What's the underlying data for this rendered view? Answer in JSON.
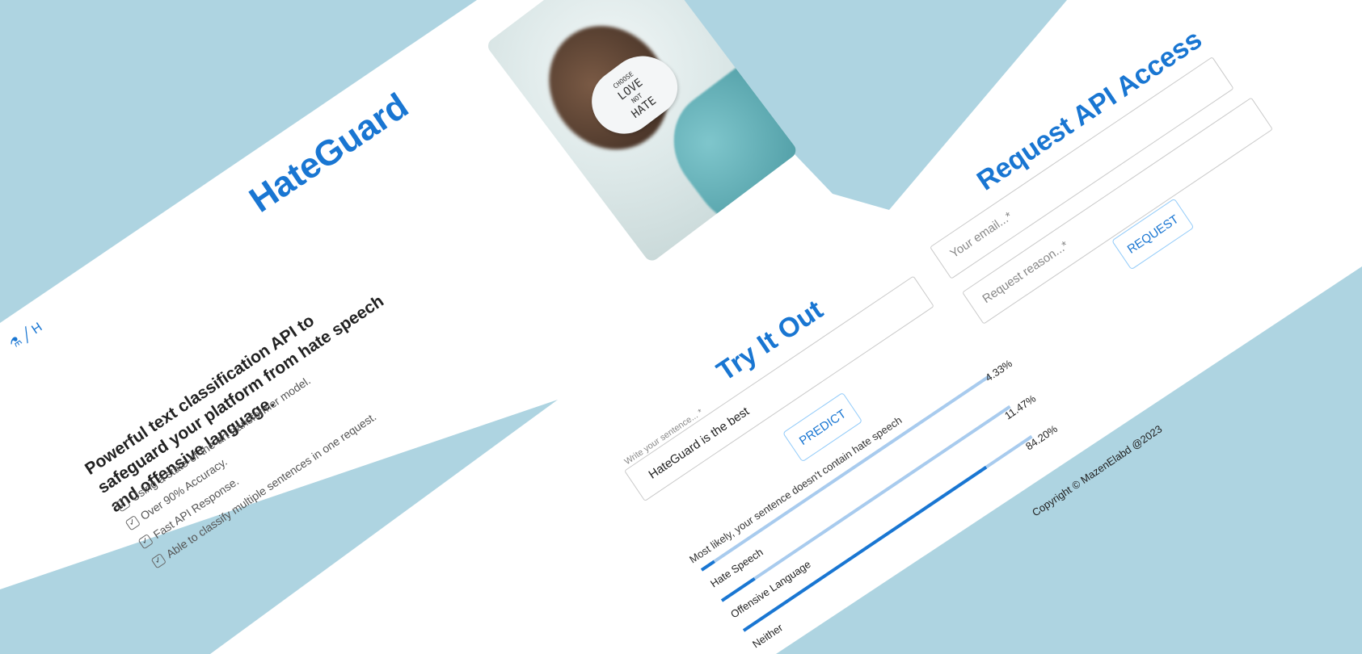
{
  "brand": {
    "title": "HateGuard",
    "nav_letter": "H"
  },
  "hero": {
    "tagline": "Powerful text classification API to safeguard your platform from hate speech and offensive language.",
    "features": [
      "Using a state-of-the-art transformer model.",
      "Over 90% Accuracy.",
      "Fast API Response.",
      "Able to classify multiple sentences in one request."
    ]
  },
  "photo": {
    "sign_lines": [
      "CHOOSE",
      "LOVE",
      "NOT",
      "HATE"
    ]
  },
  "try": {
    "title": "Try It Out",
    "input_label": "Write your sentence... *",
    "input_value": "HateGuard is the best",
    "predict_label": "PREDICT",
    "result_text": "Most likely, your sentence doesn't contain hate speech",
    "bars": [
      {
        "label": "Hate Speech",
        "percent_text": "4.33%",
        "value": 4.33
      },
      {
        "label": "Offensive Language",
        "percent_text": "11.47%",
        "value": 11.47
      },
      {
        "label": "Neither",
        "percent_text": "84.20%",
        "value": 84.2
      }
    ]
  },
  "request": {
    "title": "Request API Access",
    "email_placeholder": "Your email...*",
    "reason_placeholder": "Request reason...*",
    "button_label": "REQUEST"
  },
  "footer": {
    "copyright": "Copyright © MazenElabd @2023"
  },
  "colors": {
    "accent": "#1976d2",
    "track": "#a8cbee",
    "background": "#aed4e1"
  }
}
